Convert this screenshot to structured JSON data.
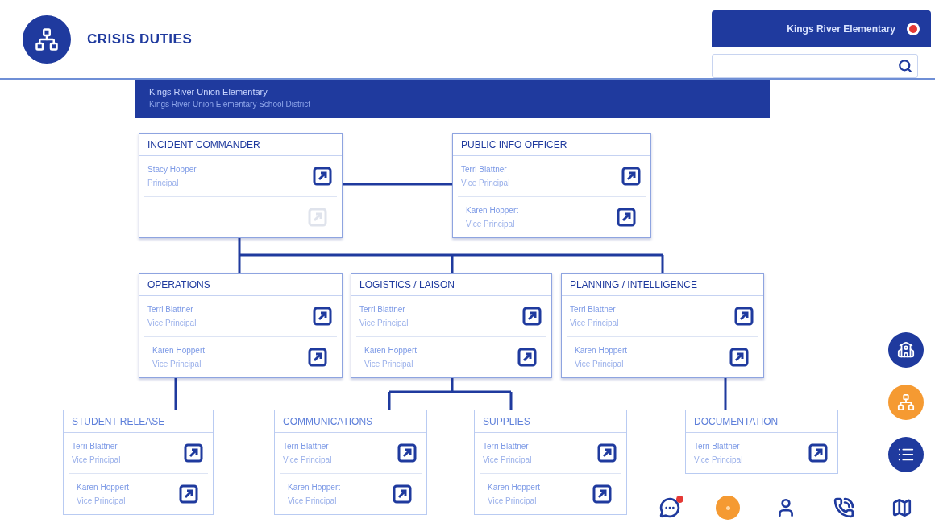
{
  "header": {
    "title": "CRISIS DUTIES",
    "school_tab": "Kings River Elementary"
  },
  "banner": {
    "title": "Kings River Union Elementary",
    "subtitle": "Kings River Union Elementary School District"
  },
  "nodes": [
    {
      "title": "INCIDENT COMMANDER",
      "people": [
        {
          "kind": "person",
          "name": "Stacy Hopper",
          "role": "Principal"
        },
        {
          "kind": "empty"
        }
      ]
    },
    {
      "title": "PUBLIC INFO OFFICER",
      "people": [
        {
          "kind": "person",
          "name": "Terri Blattner",
          "role": "Vice Principal"
        },
        {
          "kind": "person",
          "name": "Karen Hoppert",
          "role": "Vice Principal"
        }
      ]
    },
    {
      "title": "OPERATIONS",
      "people": [
        {
          "kind": "person",
          "name": "Terri Blattner",
          "role": "Vice Principal"
        },
        {
          "kind": "person",
          "name": "Karen Hoppert",
          "role": "Vice Principal"
        }
      ]
    },
    {
      "title": "LOGISTICS / LAISON",
      "people": [
        {
          "kind": "person",
          "name": "Terri Blattner",
          "role": "Vice Principal"
        },
        {
          "kind": "person",
          "name": "Karen Hoppert",
          "role": "Vice Principal"
        }
      ]
    },
    {
      "title": "PLANNING / INTELLIGENCE",
      "people": [
        {
          "kind": "person",
          "name": "Terri Blattner",
          "role": "Vice Principal"
        },
        {
          "kind": "person",
          "name": "Karen Hoppert",
          "role": "Vice Principal"
        }
      ]
    },
    {
      "title": "STUDENT RELEASE",
      "people": [
        {
          "kind": "person",
          "name": "Terri Blattner",
          "role": "Vice Principal"
        },
        {
          "kind": "person",
          "name": "Karen Hoppert",
          "role": "Vice Principal"
        }
      ]
    },
    {
      "title": "COMMUNICATIONS",
      "people": [
        {
          "kind": "person",
          "name": "Terri Blattner",
          "role": "Vice Principal"
        },
        {
          "kind": "person",
          "name": "Karen Hoppert",
          "role": "Vice Principal"
        }
      ]
    },
    {
      "title": "SUPPLIES",
      "people": [
        {
          "kind": "person",
          "name": "Terri Blattner",
          "role": "Vice Principal"
        },
        {
          "kind": "person",
          "name": "Karen Hoppert",
          "role": "Vice Principal"
        }
      ]
    },
    {
      "title": "DOCUMENTATION",
      "people": [
        {
          "kind": "person",
          "name": "Terri Blattner",
          "role": "Vice Principal"
        }
      ]
    }
  ],
  "side_buttons": [
    {
      "kind": "school",
      "selected": false
    },
    {
      "kind": "duties",
      "selected": true
    },
    {
      "kind": "list",
      "selected": false
    }
  ],
  "toolbar": [
    {
      "kind": "chat",
      "alert": true
    },
    {
      "kind": "status"
    },
    {
      "kind": "person"
    },
    {
      "kind": "phone"
    },
    {
      "kind": "map"
    }
  ]
}
